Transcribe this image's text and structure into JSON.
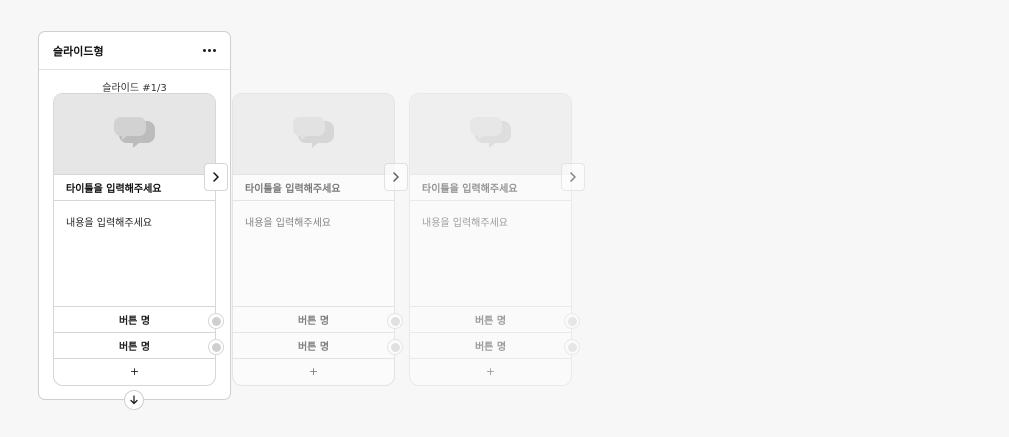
{
  "panel": {
    "title": "슬라이드형",
    "more_icon": "more-horizontal-icon",
    "slide_indicator": "슬라이드 #1/3",
    "add_below_icon": "arrow-down-icon"
  },
  "cards": [
    {
      "title": "타이틀을 입력해주세요",
      "description": "내용을 입력해주세요",
      "buttons": [
        "버튼 명",
        "버튼 명"
      ],
      "add_label": "+",
      "image_icon": "chat-bubble-icon"
    },
    {
      "title": "타이틀을 입력해주세요",
      "description": "내용을 입력해주세요",
      "buttons": [
        "버튼 명",
        "버튼 명"
      ],
      "add_label": "+",
      "image_icon": "chat-bubble-icon"
    },
    {
      "title": "타이틀을 입력해주세요",
      "description": "내용을 입력해주세요",
      "buttons": [
        "버튼 명",
        "버튼 명"
      ],
      "add_label": "+",
      "image_icon": "chat-bubble-icon"
    }
  ],
  "next_icon": "chevron-right-icon",
  "colors": {
    "background": "#f7f7f7",
    "card_border": "#d6d6d6",
    "image_placeholder": "#e6e6e6",
    "icon_gray": "#a8a8a8"
  }
}
